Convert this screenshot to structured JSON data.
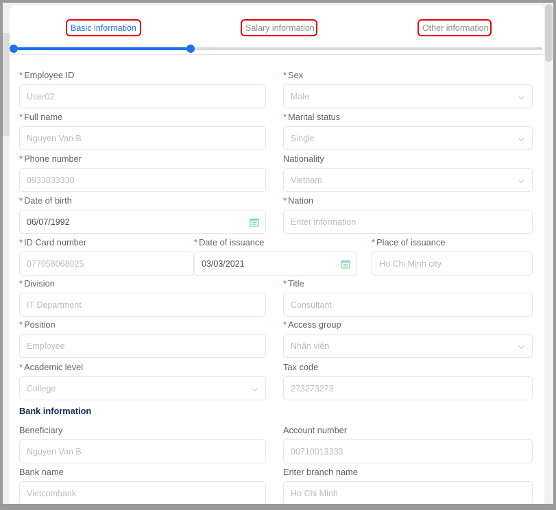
{
  "stepper": {
    "steps": [
      {
        "label": "Basic information",
        "state": "active"
      },
      {
        "label": "Salary information",
        "state": "inactive"
      },
      {
        "label": "Other information",
        "state": "inactive"
      }
    ],
    "accent_color": "#1a73e8",
    "annotation_color": "#e8000d",
    "progress_percent": 33
  },
  "form": {
    "fields": [
      {
        "label": "Employee ID",
        "required": true,
        "value": "User02",
        "filled": false,
        "control": "text"
      },
      {
        "label": "Sex",
        "required": true,
        "value": "Male",
        "filled": false,
        "control": "select"
      },
      {
        "label": "Full name",
        "required": true,
        "value": "Nguyen Van B",
        "filled": false,
        "control": "text"
      },
      {
        "label": "Marital status",
        "required": true,
        "value": "Single",
        "filled": false,
        "control": "select"
      },
      {
        "label": "Phone number",
        "required": true,
        "value": "0933033330",
        "filled": false,
        "control": "text"
      },
      {
        "label": "Nationality",
        "required": false,
        "value": "Vietnam",
        "filled": false,
        "control": "select"
      },
      {
        "label": "Date of birth",
        "required": true,
        "value": "06/07/1992",
        "filled": true,
        "control": "date"
      },
      {
        "label": "Nation",
        "required": true,
        "value": "Enter information",
        "filled": false,
        "control": "text"
      },
      {
        "label": "ID Card number",
        "required": true,
        "value": "077058068025",
        "filled": false,
        "control": "text"
      },
      {
        "label": "Date of issuance",
        "required": true,
        "value": "03/03/2021",
        "filled": true,
        "control": "date"
      },
      {
        "label": "Place of issuance",
        "required": true,
        "value": "Ho Chi Minh city",
        "filled": false,
        "control": "text"
      },
      {
        "label": "Division",
        "required": true,
        "value": "IT Department",
        "filled": false,
        "control": "text"
      },
      {
        "label": "Title",
        "required": true,
        "value": "Consultant",
        "filled": false,
        "control": "text"
      },
      {
        "label": "Position",
        "required": true,
        "value": "Employee",
        "filled": false,
        "control": "text"
      },
      {
        "label": "Access group",
        "required": true,
        "value": "Nhân viên",
        "filled": false,
        "control": "select"
      },
      {
        "label": "Academic level",
        "required": true,
        "value": "College",
        "filled": false,
        "control": "select"
      },
      {
        "label": "Tax code",
        "required": false,
        "value": "273273273",
        "filled": false,
        "control": "text"
      },
      {
        "label": "Beneficiary",
        "required": false,
        "value": "Nguyen Van B",
        "filled": false,
        "control": "text"
      },
      {
        "label": "Account number",
        "required": false,
        "value": "00710013333",
        "filled": false,
        "control": "text"
      },
      {
        "label": "Bank name",
        "required": false,
        "value": "Vietcombank",
        "filled": false,
        "control": "text"
      },
      {
        "label": "Enter branch name",
        "required": false,
        "value": "Ho Chi Minh",
        "filled": false,
        "control": "text"
      }
    ],
    "sections": [
      {
        "title": "Bank information"
      }
    ]
  }
}
